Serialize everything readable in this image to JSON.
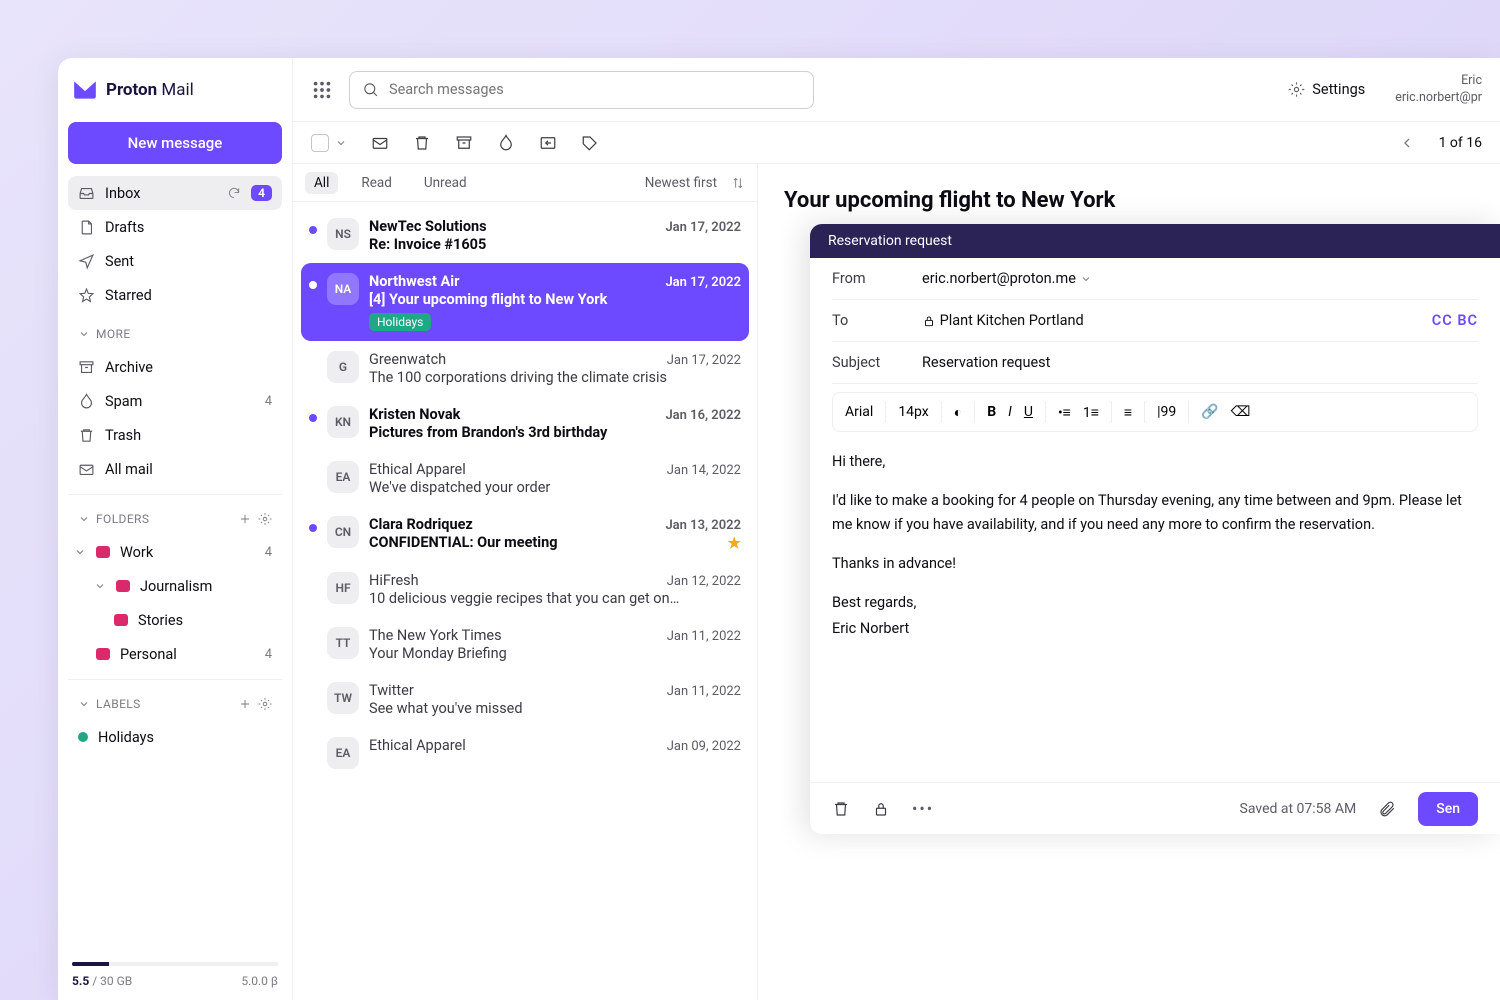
{
  "brand": {
    "name": "Proton",
    "suffix": "Mail"
  },
  "search": {
    "placeholder": "Search messages"
  },
  "settings_label": "Settings",
  "account": {
    "name": "Eric",
    "email": "eric.norbert@pr"
  },
  "new_message": "New message",
  "nav": {
    "inbox": "Inbox",
    "inbox_badge": "4",
    "drafts": "Drafts",
    "sent": "Sent",
    "starred": "Starred",
    "more": "MORE",
    "archive": "Archive",
    "spam": "Spam",
    "spam_count": "4",
    "trash": "Trash",
    "allmail": "All mail",
    "folders_label": "FOLDERS",
    "work": "Work",
    "work_count": "4",
    "journalism": "Journalism",
    "stories": "Stories",
    "personal": "Personal",
    "personal_count": "4",
    "labels_label": "LABELS",
    "holidays": "Holidays"
  },
  "storage": {
    "used": "5.5",
    "total": "/ 30 GB",
    "version": "5.0.0 β"
  },
  "toolbar": {
    "pager": "1 of 16"
  },
  "filters": {
    "all": "All",
    "read": "Read",
    "unread": "Unread",
    "sort": "Newest first"
  },
  "messages": [
    {
      "initials": "NS",
      "from": "NewTec Solutions",
      "subject": "Re: Invoice #1605",
      "date": "Jan 17, 2022",
      "unread": true
    },
    {
      "initials": "NA",
      "from": "Northwest Air",
      "subject": "[4] Your upcoming flight to New York",
      "date": "Jan 17, 2022",
      "unread": true,
      "selected": true,
      "tag": "Holidays"
    },
    {
      "initials": "G",
      "from": "Greenwatch",
      "subject": "The 100 corporations driving the climate crisis",
      "date": "Jan 17, 2022",
      "read": true
    },
    {
      "initials": "KN",
      "from": "Kristen Novak",
      "subject": "Pictures from Brandon's 3rd birthday",
      "date": "Jan 16, 2022",
      "unread": true
    },
    {
      "initials": "EA",
      "from": "Ethical Apparel",
      "subject": "We've dispatched your order",
      "date": "Jan 14, 2022",
      "read": true
    },
    {
      "initials": "CN",
      "from": "Clara Rodriquez",
      "subject": "CONFIDENTIAL: Our meeting",
      "date": "Jan 13, 2022",
      "unread": true,
      "starred": true
    },
    {
      "initials": "HF",
      "from": "HiFresh",
      "subject": "10 delicious veggie recipes that you can get on…",
      "date": "Jan 12, 2022",
      "read": true
    },
    {
      "initials": "TT",
      "from": "The New York Times",
      "subject": "Your Monday Briefing",
      "date": "Jan 11, 2022",
      "read": true
    },
    {
      "initials": "TW",
      "from": "Twitter",
      "subject": "See what you've missed",
      "date": "Jan 11, 2022",
      "read": true
    },
    {
      "initials": "EA",
      "from": "Ethical Apparel",
      "subject": "",
      "date": "Jan 09, 2022",
      "read": true
    }
  ],
  "reader": {
    "title": "Your upcoming flight to New York"
  },
  "composer": {
    "title": "Reservation request",
    "labels": {
      "from": "From",
      "to": "To",
      "subject": "Subject"
    },
    "from": "eric.norbert@proton.me",
    "to": "Plant Kitchen Portland",
    "cc": "CC BC",
    "subject": "Reservation request",
    "font": "Arial",
    "fontsize": "14px",
    "body": {
      "greeting": "Hi there,",
      "p1": "I'd like to make a booking for 4 people on Thursday evening, any time between and 9pm. Please let me know if you have availability, and if you need any more to confirm the reservation.",
      "thanks": "Thanks in advance!",
      "regards": "Best regards,",
      "sign": "Eric Norbert"
    },
    "saved": "Saved at 07:58 AM",
    "send": "Sen"
  }
}
